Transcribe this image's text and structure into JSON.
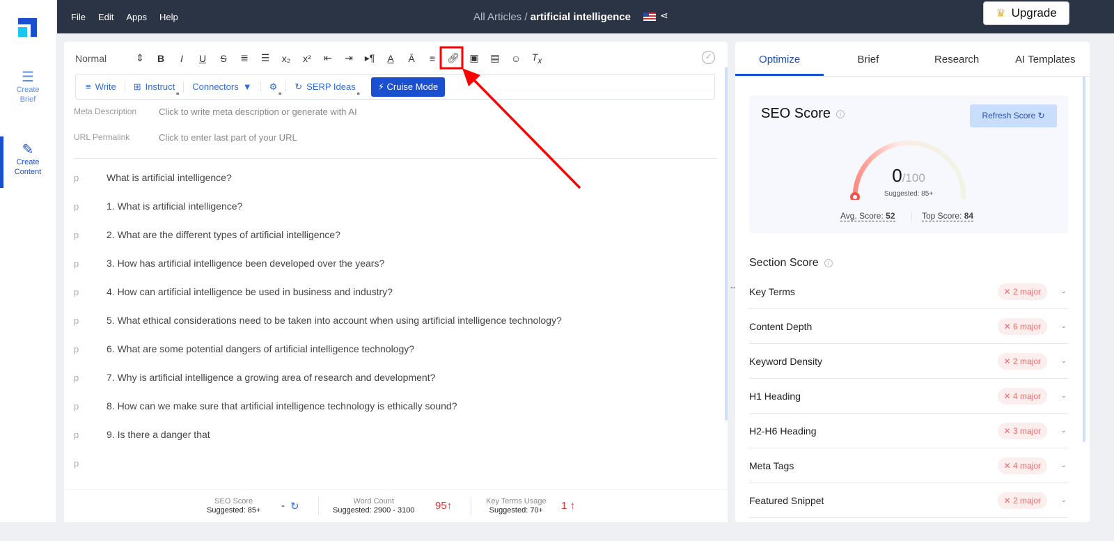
{
  "sidebar": {
    "items": [
      {
        "label_line1": "Create",
        "label_line2": "Brief"
      },
      {
        "label_line1": "Create",
        "label_line2": "Content"
      }
    ]
  },
  "topbar": {
    "menu": [
      "File",
      "Edit",
      "Apps",
      "Help"
    ],
    "breadcrumb_parent": "All Articles",
    "breadcrumb_sep": " / ",
    "breadcrumb_current": "artificial intelligence",
    "upgrade_label": "Upgrade"
  },
  "toolbar": {
    "style_select": "Normal"
  },
  "ai_bar": {
    "write": "Write",
    "instruct": "Instruct",
    "connectors": "Connectors",
    "serp": "SERP Ideas",
    "cruise": "Cruise Mode"
  },
  "meta": {
    "description_label": "Meta Description",
    "description_placeholder": "Click to write meta description or generate with AI",
    "permalink_label": "URL Permalink",
    "permalink_placeholder": "Click to enter last part of your URL"
  },
  "paragraphs": [
    "What is artificial intelligence?",
    "1. What is artificial intelligence?",
    "2. What are the different types of artificial intelligence?",
    "3. How has artificial intelligence been developed over the years?",
    "4. How can artificial intelligence be used in business and industry?",
    "5. What ethical considerations need to be taken into account when using artificial intelligence technology?",
    "6. What are some potential dangers of artificial intelligence technology?",
    "7. Why is artificial intelligence a growing area of research and development?",
    "8. How can we make sure that artificial intelligence technology is ethically sound?",
    "9. Is there a danger that",
    ""
  ],
  "para_tag": "p",
  "bottom": {
    "seo_label": "SEO Score",
    "seo_sugg": "Suggested: 85+",
    "seo_value": "-",
    "wc_label": "Word Count",
    "wc_sugg": "Suggested: 2900 - 3100",
    "wc_value": "95↑",
    "kt_label": "Key Terms Usage",
    "kt_sugg": "Suggested: 70+",
    "kt_value": "1 ↑"
  },
  "right": {
    "tabs": [
      "Optimize",
      "Brief",
      "Research",
      "AI Templates"
    ],
    "seo_title": "SEO Score",
    "refresh": "Refresh Score",
    "score": "0",
    "score_max": "/100",
    "score_fraction": 0,
    "suggested": "Suggested: 85+",
    "avg_label": "Avg. Score: ",
    "avg": "52",
    "top_label": "Top Score: ",
    "top": "84",
    "section_title": "Section Score",
    "sections": [
      {
        "name": "Key Terms",
        "badge": "2 major"
      },
      {
        "name": "Content Depth",
        "badge": "6 major"
      },
      {
        "name": "Keyword Density",
        "badge": "2 major"
      },
      {
        "name": "H1 Heading",
        "badge": "4 major"
      },
      {
        "name": "H2-H6 Heading",
        "badge": "3 major"
      },
      {
        "name": "Meta Tags",
        "badge": "4 major"
      },
      {
        "name": "Featured Snippet",
        "badge": "2 major"
      }
    ]
  },
  "colors": {
    "accent": "#1a4fd0",
    "topbar": "#2b3445",
    "danger": "#e53030",
    "annotation": "#ff0000"
  }
}
